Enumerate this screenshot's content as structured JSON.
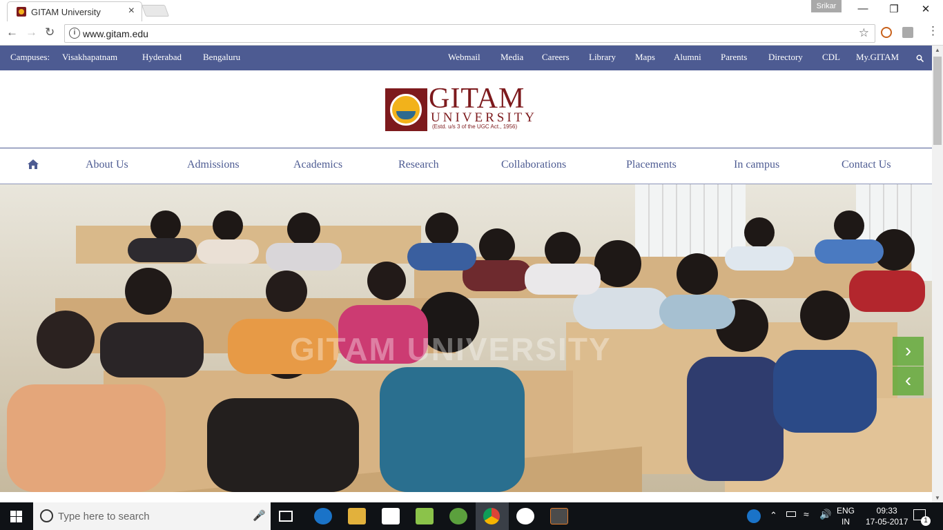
{
  "browser": {
    "tab_title": "GITAM University",
    "tab_close": "×",
    "profile_name": "Srikar",
    "url": "www.gitam.edu",
    "window_minimize": "—",
    "window_restore": "❐",
    "window_close": "✕"
  },
  "topnav": {
    "campuses_label": "Campuses:",
    "campuses": [
      "Visakhapatnam",
      "Hyderabad",
      "Bengaluru"
    ],
    "links": [
      "Webmail",
      "Media",
      "Careers",
      "Library",
      "Maps",
      "Alumni",
      "Parents",
      "Directory",
      "CDL",
      "My.GITAM"
    ]
  },
  "logo": {
    "name": "GITAM",
    "subtitle": "UNIVERSITY",
    "estd": "(Estd. u/s 3 of the UGC Act., 1956)"
  },
  "mainnav": {
    "items": [
      "About Us",
      "Admissions",
      "Academics",
      "Research",
      "Collaborations",
      "Placements",
      "In campus",
      "Contact Us"
    ]
  },
  "hero": {
    "watermark": "GITAM UNIVERSITY"
  },
  "taskbar": {
    "search_placeholder": "Type here to search",
    "language_top": "ENG",
    "language_bottom": "IN",
    "time": "09:33",
    "date": "17-05-2017",
    "notification_count": "1"
  },
  "colors": {
    "brand_navy": "#4d5b92",
    "brand_maroon": "#7d1a1d",
    "slider_green": "#64aa3c"
  }
}
